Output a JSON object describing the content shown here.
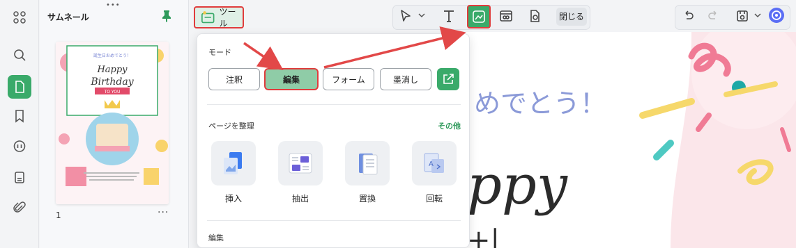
{
  "thumbnail_panel": {
    "title": "サムネール",
    "page_number": "1",
    "more": "···",
    "grip": "•••",
    "thumbnail": {
      "banner": "誕生日おめでとう！",
      "title_line1": "Happy",
      "title_line2": "Birthday",
      "subtitle": "TO YOU"
    }
  },
  "rail": {
    "items": [
      {
        "name": "apps-icon",
        "active": false
      },
      {
        "name": "search-icon",
        "active": false
      },
      {
        "name": "page-icon",
        "active": true
      },
      {
        "name": "bookmark-icon",
        "active": false
      },
      {
        "name": "comment-icon",
        "active": false
      },
      {
        "name": "stamp-icon",
        "active": false
      },
      {
        "name": "attachment-icon",
        "active": false
      }
    ]
  },
  "toolbar": {
    "tool_label": "ツール",
    "close_label": "閉じる"
  },
  "dropdown": {
    "mode_label": "モード",
    "modes": [
      "注釈",
      "編集",
      "フォーム",
      "墨消し"
    ],
    "active_mode": "編集",
    "organize_label": "ページを整理",
    "more_label": "その他",
    "organize_tools": [
      "挿入",
      "抽出",
      "置換",
      "回転"
    ],
    "edit_label": "編集"
  },
  "document": {
    "greeting": "めでとう！",
    "big_text_1": "ppy",
    "big_text_2": "+|"
  },
  "colors": {
    "accent": "#3aaa6a",
    "highlight": "#e03c3c",
    "greeting": "#8b9ad8"
  }
}
